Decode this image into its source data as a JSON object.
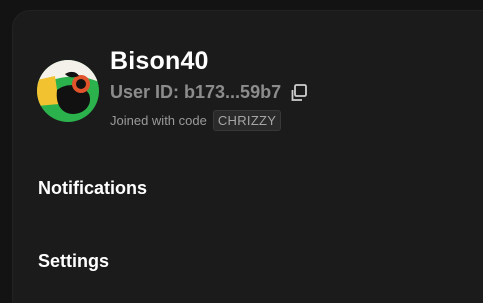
{
  "profile": {
    "username": "Bison40",
    "user_id": "User ID: b173...59b7",
    "joined_label": "Joined with code",
    "join_code": "CHRIZZY"
  },
  "menu": {
    "items": [
      {
        "label": "Notifications"
      },
      {
        "label": "Settings"
      }
    ]
  },
  "icons": {
    "copy": "copy-icon",
    "avatar": "avatar"
  },
  "colors": {
    "background": "#131313",
    "panel": "#1b1b1b",
    "text_primary": "#ffffff",
    "text_secondary": "#8c8c8c",
    "avatar_green": "#2bb24c",
    "avatar_yellow": "#f2c230",
    "avatar_orange": "#e0532b"
  }
}
